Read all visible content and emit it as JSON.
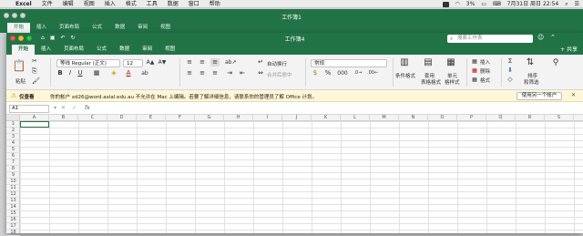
{
  "menubar": {
    "app": "Excel",
    "items": [
      "文件",
      "编辑",
      "视图",
      "插入",
      "格式",
      "工具",
      "数据",
      "窗口",
      "帮助"
    ],
    "battery": "3%",
    "datetime": "7月31日 周日 22:54"
  },
  "bg_window": {
    "title": "工作簿1",
    "tabs": [
      "开始",
      "插入",
      "页面布局",
      "公式",
      "数据",
      "审阅",
      "视图"
    ]
  },
  "window": {
    "title": "工作簿4",
    "search_placeholder": "搜索工作表",
    "tabs": [
      "开始",
      "插入",
      "页面布局",
      "公式",
      "数据",
      "审阅",
      "视图"
    ],
    "share_label": "+ 共享"
  },
  "ribbon": {
    "paste": "粘贴",
    "font": "等线 Regular (正文)",
    "size": "12",
    "wrap": "自动换行",
    "merge": "合并后居中",
    "number_format": "常规",
    "cond_format": "条件格式",
    "table_format": [
      "套用",
      "表格格式"
    ],
    "cell_style": [
      "单元",
      "格样式"
    ],
    "insert": "插入",
    "delete": "删除",
    "format": "格式",
    "sort": [
      "排序",
      "和筛选"
    ]
  },
  "infobar": {
    "label": "仅查看",
    "message": "你的帐户 xd26@word.axial.edu.au 不允许在 Mac 上编辑。若要了解详细信息，请联系你的管理员了解 Office 计划。",
    "button": "使用另一个帐户"
  },
  "formula": {
    "namebox": "A1",
    "fx": "fx",
    "value": ""
  },
  "columns": [
    "A",
    "B",
    "C",
    "D",
    "E",
    "F",
    "G",
    "H",
    "I",
    "J",
    "K",
    "L",
    "M",
    "N",
    "O",
    "P",
    "Q",
    "R",
    "S"
  ],
  "rows": [
    "1",
    "2",
    "3",
    "4",
    "5",
    "6",
    "7",
    "8",
    "9",
    "10",
    "11",
    "12",
    "13",
    "14",
    "15",
    "16",
    "17",
    "18"
  ]
}
